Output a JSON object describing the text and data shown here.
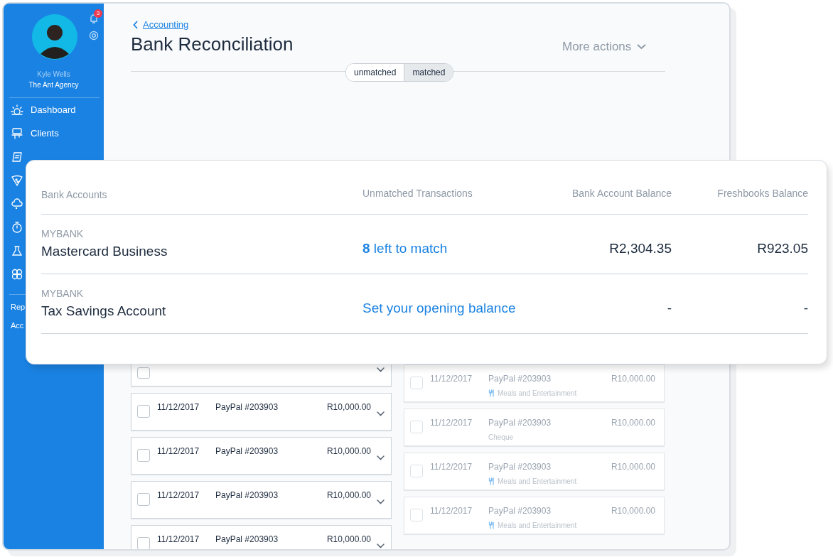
{
  "sidebar": {
    "user_name": "Kyle Wells",
    "company": "The Ant Agency",
    "notifications": "3",
    "nav": [
      {
        "kind": "labeled",
        "label": "Dashboard",
        "selected": false
      },
      {
        "kind": "labeled",
        "label": "Clients",
        "selected": false
      },
      {
        "kind": "icon"
      },
      {
        "kind": "icon"
      },
      {
        "kind": "icon"
      },
      {
        "kind": "icon"
      },
      {
        "kind": "icon"
      },
      {
        "kind": "icon"
      }
    ],
    "secondary": [
      {
        "label": "Rep"
      },
      {
        "label": "Acc"
      }
    ]
  },
  "breadcrumb": "Accounting",
  "title": "Bank Reconciliation",
  "more_actions": "More actions",
  "toggle": [
    {
      "label": "unmatched",
      "selected": false
    },
    {
      "label": "matched",
      "selected": true
    }
  ],
  "lists": [
    {
      "dimmed": false,
      "items": [
        {
          "kind": "covered"
        },
        {
          "date": "11/12/2017",
          "description": "PayPal #203903",
          "amount": "R10,000.00"
        },
        {
          "date": "11/12/2017",
          "description": "PayPal #203903",
          "amount": "R10,000.00"
        },
        {
          "date": "11/12/2017",
          "description": "PayPal #203903",
          "amount": "R10,000.00"
        },
        {
          "date": "11/12/2017",
          "description": "PayPal #203903",
          "amount": "R10,000.00"
        }
      ]
    },
    {
      "dimmed": true,
      "items": [
        {
          "date": "11/12/2017",
          "description": "PayPal #203903",
          "amount": "R10,000.00",
          "category": "Meals and Entertainment",
          "has_icon": true
        },
        {
          "date": "11/12/2017",
          "description": "PayPal #203903",
          "amount": "R10,000.00",
          "category": "Cheque",
          "has_icon": false
        },
        {
          "date": "11/12/2017",
          "description": "PayPal #203903",
          "amount": "R10,000.00",
          "category": "Meals and Entertainment",
          "has_icon": true
        },
        {
          "date": "11/12/2017",
          "description": "PayPal #203903",
          "amount": "R10,000.00",
          "category": "Meals and Entertainment",
          "has_icon": true
        }
      ]
    }
  ],
  "accounts_card": {
    "columns": [
      "Bank Accounts",
      "Unmatched Transactions",
      "Bank Account Balance",
      "Freshbooks Balance"
    ],
    "rows": [
      {
        "bank": "MYBANK",
        "name": "Mastercard Business",
        "action": "**8** left to match",
        "bank_balance": "R2,304.35",
        "freshbooks_balance": "R923.05"
      },
      {
        "bank": "MYBANK",
        "name": "Tax Savings Account",
        "action": "Set your opening balance",
        "bank_balance": "-",
        "freshbooks_balance": "-"
      }
    ]
  }
}
